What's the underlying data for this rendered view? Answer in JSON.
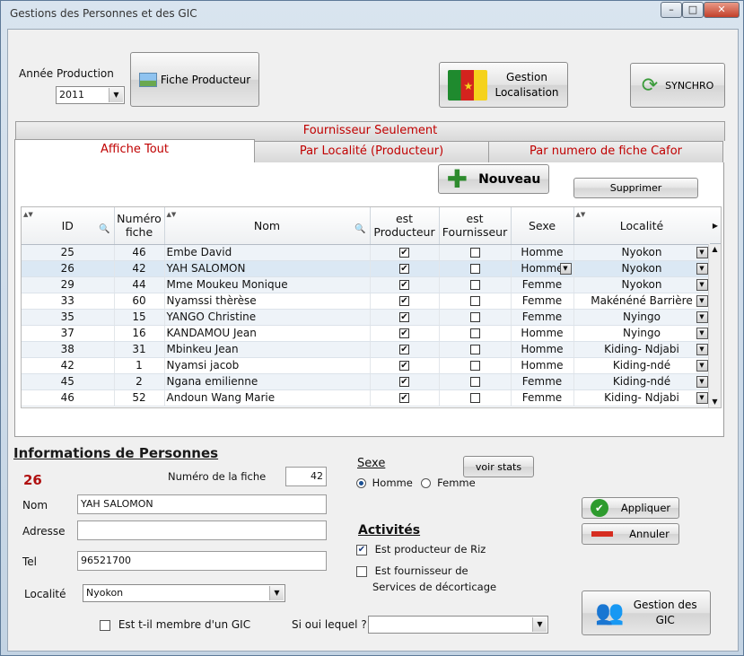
{
  "window": {
    "title": "Gestions des Personnes et des GIC"
  },
  "header": {
    "annee_label": "Année Production",
    "annee_value": "2011",
    "fiche_producteur": "Fiche Producteur",
    "gestion_localisation_line1": "Gestion",
    "gestion_localisation_line2": "Localisation",
    "synchro": "SYNCHRO"
  },
  "tabs": {
    "fournisseur": "Fournisseur Seulement",
    "affiche_tout": "Affiche Tout",
    "par_localite": "Par Localité (Producteur)",
    "par_numero": "Par numero de fiche Cafor (producteurs)"
  },
  "toolbar": {
    "nouveau": "Nouveau",
    "supprimer": "Supprimer"
  },
  "grid": {
    "headers": {
      "id": "ID",
      "numero_line1": "Numéro",
      "numero_line2": "fiche",
      "nom": "Nom",
      "producteur_line1": "est",
      "producteur_line2": "Producteur",
      "fournisseur_line1": "est",
      "fournisseur_line2": "Fournisseur",
      "sexe": "Sexe",
      "localite": "Localité"
    },
    "rows": [
      {
        "id": "25",
        "num": "46",
        "nom": "Embe David",
        "prod": true,
        "four": false,
        "sexe": "Homme",
        "loc": "Nyokon"
      },
      {
        "id": "26",
        "num": "42",
        "nom": "YAH SALOMON",
        "prod": true,
        "four": false,
        "sexe": "Homme",
        "loc": "Nyokon"
      },
      {
        "id": "29",
        "num": "44",
        "nom": "Mme Moukeu Monique",
        "prod": true,
        "four": false,
        "sexe": "Femme",
        "loc": "Nyokon"
      },
      {
        "id": "33",
        "num": "60",
        "nom": "Nyamssi thèrèse",
        "prod": true,
        "four": false,
        "sexe": "Femme",
        "loc": "Makénéné Barrière"
      },
      {
        "id": "35",
        "num": "15",
        "nom": "YANGO Christine",
        "prod": true,
        "four": false,
        "sexe": "Femme",
        "loc": "Nyingo"
      },
      {
        "id": "37",
        "num": "16",
        "nom": "KANDAMOU Jean",
        "prod": true,
        "four": false,
        "sexe": "Homme",
        "loc": "Nyingo"
      },
      {
        "id": "38",
        "num": "31",
        "nom": "Mbinkeu Jean",
        "prod": true,
        "four": false,
        "sexe": "Homme",
        "loc": "Kiding- Ndjabi"
      },
      {
        "id": "42",
        "num": "1",
        "nom": "Nyamsi jacob",
        "prod": true,
        "four": false,
        "sexe": "Homme",
        "loc": "Kiding-ndé"
      },
      {
        "id": "45",
        "num": "2",
        "nom": "Ngana emilienne",
        "prod": true,
        "four": false,
        "sexe": "Femme",
        "loc": "Kiding-ndé"
      },
      {
        "id": "46",
        "num": "52",
        "nom": "Andoun Wang Marie",
        "prod": true,
        "four": false,
        "sexe": "Femme",
        "loc": "Kiding- Ndjabi"
      }
    ]
  },
  "form": {
    "section_title": "Informations de Personnes",
    "id_value": "26",
    "numero_label": "Numéro de la fiche",
    "numero_value": "42",
    "nom_label": "Nom",
    "nom_value": "YAH SALOMON",
    "adresse_label": "Adresse",
    "adresse_value": "",
    "tel_label": "Tel",
    "tel_value": "96521700",
    "localite_label": "Localité",
    "localite_value": "Nyokon",
    "gic_member_label": "Est t-il membre d'un GIC",
    "si_oui_label": "Si oui lequel ?",
    "sexe_title": "Sexe",
    "voir_stats": "voir stats",
    "homme": "Homme",
    "femme": "Femme",
    "activites_title": "Activités",
    "producteur_riz": "Est producteur de Riz",
    "fournisseur_line1": "Est fournisseur de",
    "fournisseur_line2": "Services de décorticage",
    "appliquer": "Appliquer",
    "annuler": "Annuler",
    "gestion_gic_line1": "Gestion des",
    "gestion_gic_line2": "GIC"
  }
}
